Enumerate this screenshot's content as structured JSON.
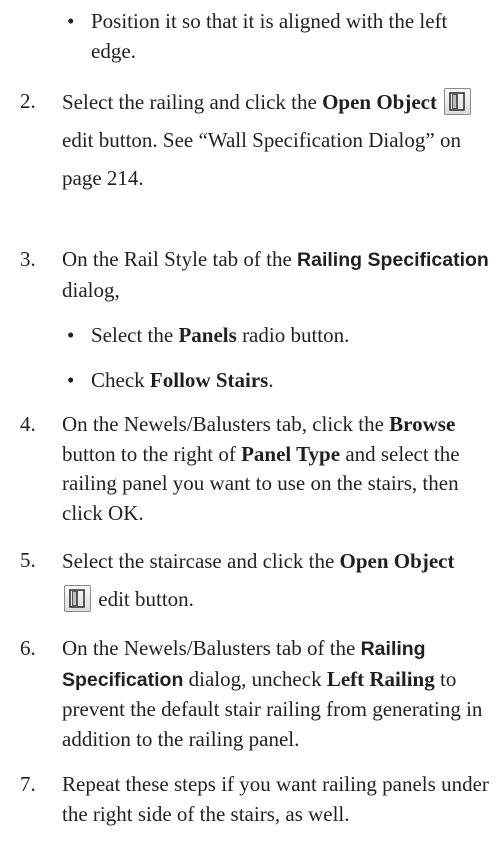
{
  "bullet0": {
    "symbol": "•",
    "text": "Position it so that it is aligned with the left edge."
  },
  "step2": {
    "num": "2.",
    "pre": "Select the railing and click the ",
    "b1": "Open Object",
    "mid": " edit button. See “Wall Specification Dialog” on page 214.",
    "icon": "open-object-icon"
  },
  "step3": {
    "num": "3.",
    "pre": "On the Rail Style tab of the ",
    "b1": "Railing Specification",
    "post": " dialog,",
    "bullets": [
      {
        "symbol": "•",
        "pre": "Select the ",
        "bold": "Panels",
        "post": " radio button."
      },
      {
        "symbol": "•",
        "pre": "Check ",
        "bold": "Follow Stairs",
        "post": "."
      }
    ]
  },
  "step4": {
    "num": "4.",
    "pre": "On the Newels/Balusters tab, click the ",
    "b1": "Browse",
    "mid": " button to the right of ",
    "b2": "Panel Type",
    "post": " and select the railing panel you want to use on the stairs, then click OK."
  },
  "step5": {
    "num": "5.",
    "pre": "Select the staircase and click the ",
    "b1": "Open Object",
    "post": " edit button.",
    "icon": "open-object-icon"
  },
  "step6": {
    "num": "6.",
    "pre": "On the Newels/Balusters tab of the ",
    "b1": "Railing Specification",
    "mid": " dialog, uncheck ",
    "b2": "Left Railing",
    "post": " to prevent the default stair railing from generating in addition to the railing panel."
  },
  "step7": {
    "num": "7.",
    "text": "Repeat these steps if you want railing panels under the right side of the stairs, as well."
  }
}
